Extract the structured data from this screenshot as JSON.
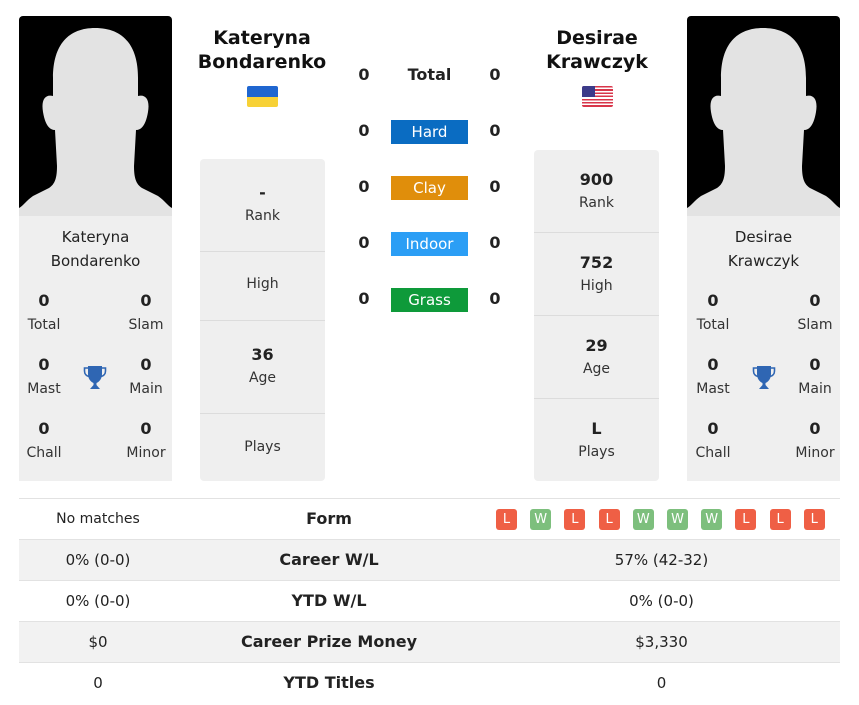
{
  "colors": {
    "hard": "#0a6cc2",
    "clay": "#e08e0b",
    "indoor": "#2b9ef5",
    "grass": "#0e9a3a",
    "win": "#7dbf7d",
    "loss": "#ef5f45",
    "trophy": "#2f66b3"
  },
  "player1": {
    "name_line1": "Kateryna",
    "name_line2": "Bondarenko",
    "card_name_line1": "Kateryna",
    "card_name_line2": "Bondarenko",
    "flag": "ukraine-flag",
    "titles": {
      "total": {
        "value": "0",
        "label": "Total"
      },
      "slam": {
        "value": "0",
        "label": "Slam"
      },
      "mast": {
        "value": "0",
        "label": "Mast"
      },
      "main": {
        "value": "0",
        "label": "Main"
      },
      "chall": {
        "value": "0",
        "label": "Chall"
      },
      "minor": {
        "value": "0",
        "label": "Minor"
      }
    },
    "rank": {
      "value": "-",
      "label": "Rank"
    },
    "high": {
      "value": "",
      "label": "High"
    },
    "age": {
      "value": "36",
      "label": "Age"
    },
    "plays": {
      "value": "",
      "label": "Plays"
    }
  },
  "player2": {
    "name_line1": "Desirae",
    "name_line2": "Krawczyk",
    "card_name_line1": "Desirae",
    "card_name_line2": "Krawczyk",
    "flag": "usa-flag",
    "titles": {
      "total": {
        "value": "0",
        "label": "Total"
      },
      "slam": {
        "value": "0",
        "label": "Slam"
      },
      "mast": {
        "value": "0",
        "label": "Mast"
      },
      "main": {
        "value": "0",
        "label": "Main"
      },
      "chall": {
        "value": "0",
        "label": "Chall"
      },
      "minor": {
        "value": "0",
        "label": "Minor"
      }
    },
    "rank": {
      "value": "900",
      "label": "Rank"
    },
    "high": {
      "value": "752",
      "label": "High"
    },
    "age": {
      "value": "29",
      "label": "Age"
    },
    "plays": {
      "value": "L",
      "label": "Plays"
    }
  },
  "h2h": [
    {
      "label": "Total",
      "p1": "0",
      "p2": "0"
    },
    {
      "label": "Hard",
      "p1": "0",
      "p2": "0"
    },
    {
      "label": "Clay",
      "p1": "0",
      "p2": "0"
    },
    {
      "label": "Indoor",
      "p1": "0",
      "p2": "0"
    },
    {
      "label": "Grass",
      "p1": "0",
      "p2": "0"
    }
  ],
  "table": {
    "form": {
      "label": "Form",
      "p1": "No matches",
      "p2": [
        "L",
        "W",
        "L",
        "L",
        "W",
        "W",
        "W",
        "L",
        "L",
        "L"
      ]
    },
    "career_wl": {
      "label": "Career W/L",
      "p1": "0% (0-0)",
      "p2": "57% (42-32)"
    },
    "ytd_wl": {
      "label": "YTD W/L",
      "p1": "0% (0-0)",
      "p2": "0% (0-0)"
    },
    "prize": {
      "label": "Career Prize Money",
      "p1": "$0",
      "p2": "$3,330"
    },
    "ytd_titles": {
      "label": "YTD Titles",
      "p1": "0",
      "p2": "0"
    }
  }
}
